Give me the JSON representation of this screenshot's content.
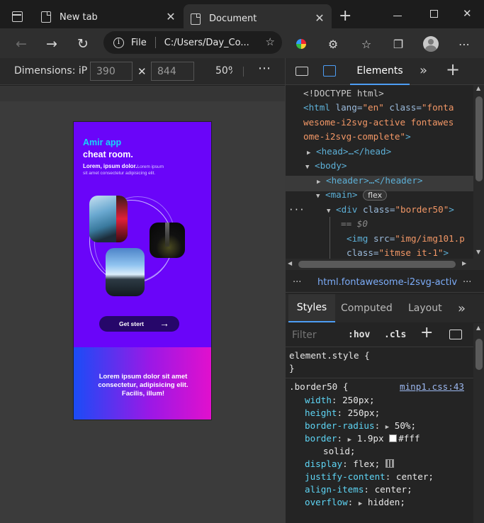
{
  "tabs": [
    {
      "label": "New tab"
    },
    {
      "label": "Document"
    }
  ],
  "address": {
    "scheme": "File",
    "path": "C:/Users/Day_Co..."
  },
  "device_toolbar": {
    "label": "Dimensions: iP",
    "width": "390",
    "height": "844",
    "zoom": "50%"
  },
  "phone": {
    "title_line1": "Amir app",
    "title_line2": "cheat room.",
    "lead_bold": "Lorem, ipsum dolor.",
    "lead_rest": "Lorem ipsum",
    "lead_line2": "sit amet consectetur adipisicing elit.",
    "button_label": "Get stert",
    "footer_text": "Lorem ipsum dolor sit amet consectetur, adipisicing elit. Facilis, illum!"
  },
  "devtools": {
    "tab_elements": "Elements",
    "dom_lines": {
      "doctype": "<!DOCTYPE html>",
      "html_open": "<html",
      "html_attr_lang": "lang",
      "html_val_lang": "\"en\"",
      "html_attr_class": "class",
      "html_val_class_1": "\"fonta",
      "html_val_class_2": "wesome-i2svg-active fontawes",
      "html_val_class_3": "ome-i2svg-complete\"",
      "head": "<head>…</head>",
      "body": "<body>",
      "header": "<header>…</header>",
      "main": "<main>",
      "flex_badge": "flex",
      "div": "<div",
      "div_attr": "class",
      "div_val": "\"border50\"",
      "eq0": "== $0",
      "img": "<img",
      "img_attr": "src",
      "img_val": "\"img/img101.p",
      "img_attr2": "class",
      "img_val2": "\"itmse it-1\""
    },
    "breadcrumb": "html.fontawesome-i2svg-activ",
    "style_tabs": [
      "Styles",
      "Computed",
      "Layout"
    ],
    "filter_placeholder": "Filter",
    "hov": ":hov",
    "cls": ".cls",
    "element_style": "element.style {",
    "close_brace": "}",
    "rule_selector": ".border50 {",
    "rule_source": "minp1.css:43",
    "declarations": [
      {
        "prop": "width",
        "value": "250px;"
      },
      {
        "prop": "height",
        "value": "250px;"
      },
      {
        "prop": "border-radius",
        "value": "50%;"
      },
      {
        "prop": "border",
        "value": "1.9px",
        "extra": "#fff"
      },
      {
        "prop": "",
        "value": "solid;"
      },
      {
        "prop": "display",
        "value": "flex;"
      },
      {
        "prop": "justify-content",
        "value": "center;"
      },
      {
        "prop": "align-items",
        "value": "center;"
      },
      {
        "prop": "overflow",
        "value": "hidden;"
      }
    ]
  }
}
